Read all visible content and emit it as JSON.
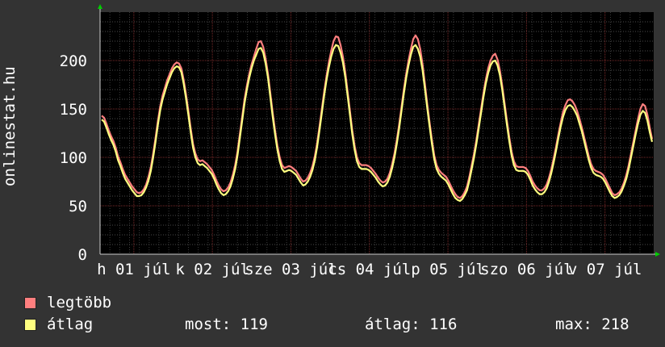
{
  "chart_data": {
    "type": "line",
    "ylabel": "onlinestat.hu",
    "ylim": [
      0,
      250
    ],
    "yticks": [
      0,
      50,
      100,
      150,
      200
    ],
    "xtick_labels": [
      "h 01 júl",
      "k 02 júl",
      "sze 03 júl",
      "cs 04 júl",
      "p 05 júl",
      "szo 06 júl",
      "v 07 júl"
    ],
    "x_days": [
      0,
      1,
      2,
      3,
      4,
      5,
      6
    ],
    "series": [
      {
        "name": "legtöbb",
        "color": "#ff7f7f",
        "values": [
          143,
          141,
          135,
          128,
          122,
          117,
          110,
          101,
          95,
          88,
          82,
          78,
          74,
          70,
          67,
          64,
          63,
          64,
          67,
          72,
          80,
          90,
          104,
          120,
          138,
          153,
          164,
          172,
          180,
          186,
          192,
          196,
          198,
          197,
          192,
          180,
          165,
          148,
          130,
          114,
          104,
          98,
          96,
          97,
          95,
          93,
          90,
          87,
          82,
          76,
          71,
          67,
          65,
          66,
          69,
          74,
          82,
          92,
          106,
          124,
          142,
          160,
          174,
          186,
          196,
          204,
          212,
          219,
          220,
          214,
          202,
          186,
          166,
          146,
          128,
          112,
          100,
          92,
          89,
          90,
          91,
          90,
          88,
          86,
          82,
          78,
          75,
          76,
          79,
          84,
          91,
          101,
          115,
          132,
          150,
          168,
          184,
          198,
          210,
          220,
          225,
          224,
          216,
          204,
          188,
          168,
          148,
          128,
          112,
          100,
          94,
          92,
          92,
          92,
          91,
          89,
          86,
          83,
          79,
          76,
          74,
          75,
          78,
          84,
          93,
          104,
          118,
          134,
          152,
          170,
          186,
          200,
          212,
          222,
          226,
          222,
          212,
          196,
          176,
          155,
          136,
          118,
          102,
          92,
          87,
          84,
          82,
          80,
          76,
          71,
          66,
          62,
          59,
          58,
          60,
          64,
          70,
          80,
          92,
          104,
          118,
          134,
          150,
          166,
          180,
          192,
          200,
          205,
          207,
          201,
          190,
          174,
          156,
          138,
          121,
          106,
          96,
          91,
          90,
          90,
          90,
          89,
          86,
          81,
          75,
          71,
          68,
          66,
          66,
          68,
          72,
          79,
          88,
          99,
          111,
          124,
          136,
          147,
          154,
          159,
          160,
          158,
          154,
          148,
          140,
          131,
          121,
          111,
          101,
          93,
          88,
          86,
          85,
          84,
          82,
          78,
          73,
          68,
          63,
          61,
          62,
          64,
          68,
          74,
          82,
          92,
          104,
          116,
          128,
          140,
          150,
          155,
          153,
          144,
          131,
          119
        ]
      },
      {
        "name": "átlag",
        "color": "#ffff80",
        "values": [
          139,
          137,
          131,
          124,
          118,
          113,
          106,
          97,
          91,
          84,
          78,
          74,
          70,
          66,
          63,
          60,
          60,
          61,
          64,
          69,
          76,
          86,
          100,
          116,
          134,
          149,
          160,
          168,
          176,
          182,
          188,
          192,
          194,
          193,
          188,
          176,
          161,
          144,
          126,
          110,
          100,
          94,
          92,
          93,
          91,
          89,
          86,
          83,
          78,
          72,
          67,
          63,
          61,
          62,
          65,
          70,
          78,
          88,
          102,
          120,
          138,
          156,
          170,
          182,
          192,
          200,
          206,
          212,
          213,
          208,
          197,
          182,
          162,
          142,
          124,
          108,
          96,
          88,
          85,
          86,
          87,
          86,
          84,
          82,
          78,
          74,
          71,
          72,
          75,
          80,
          87,
          97,
          111,
          128,
          146,
          164,
          180,
          193,
          204,
          212,
          216,
          215,
          208,
          198,
          183,
          164,
          144,
          124,
          108,
          96,
          90,
          88,
          88,
          88,
          87,
          85,
          82,
          79,
          75,
          72,
          70,
          71,
          74,
          80,
          89,
          100,
          114,
          130,
          148,
          166,
          182,
          195,
          206,
          214,
          216,
          212,
          204,
          190,
          171,
          151,
          132,
          114,
          98,
          88,
          83,
          80,
          78,
          76,
          72,
          67,
          62,
          58,
          56,
          55,
          57,
          61,
          66,
          76,
          88,
          100,
          114,
          130,
          146,
          162,
          176,
          187,
          195,
          199,
          200,
          195,
          185,
          170,
          152,
          134,
          117,
          102,
          92,
          87,
          86,
          86,
          86,
          85,
          82,
          77,
          71,
          67,
          64,
          62,
          62,
          64,
          68,
          75,
          84,
          95,
          107,
          120,
          132,
          142,
          149,
          153,
          154,
          152,
          148,
          143,
          135,
          127,
          117,
          107,
          97,
          89,
          84,
          82,
          81,
          80,
          78,
          74,
          69,
          64,
          60,
          58,
          59,
          61,
          65,
          71,
          78,
          88,
          100,
          112,
          124,
          135,
          144,
          148,
          146,
          138,
          126,
          116
        ]
      }
    ]
  },
  "legend": [
    {
      "label": "legtöbb",
      "color": "#ff7f7f"
    },
    {
      "label": "átlag",
      "color": "#ffff80"
    }
  ],
  "stats": {
    "most": "most: 119",
    "atlag": "átlag: 116",
    "max": "max: 218"
  }
}
